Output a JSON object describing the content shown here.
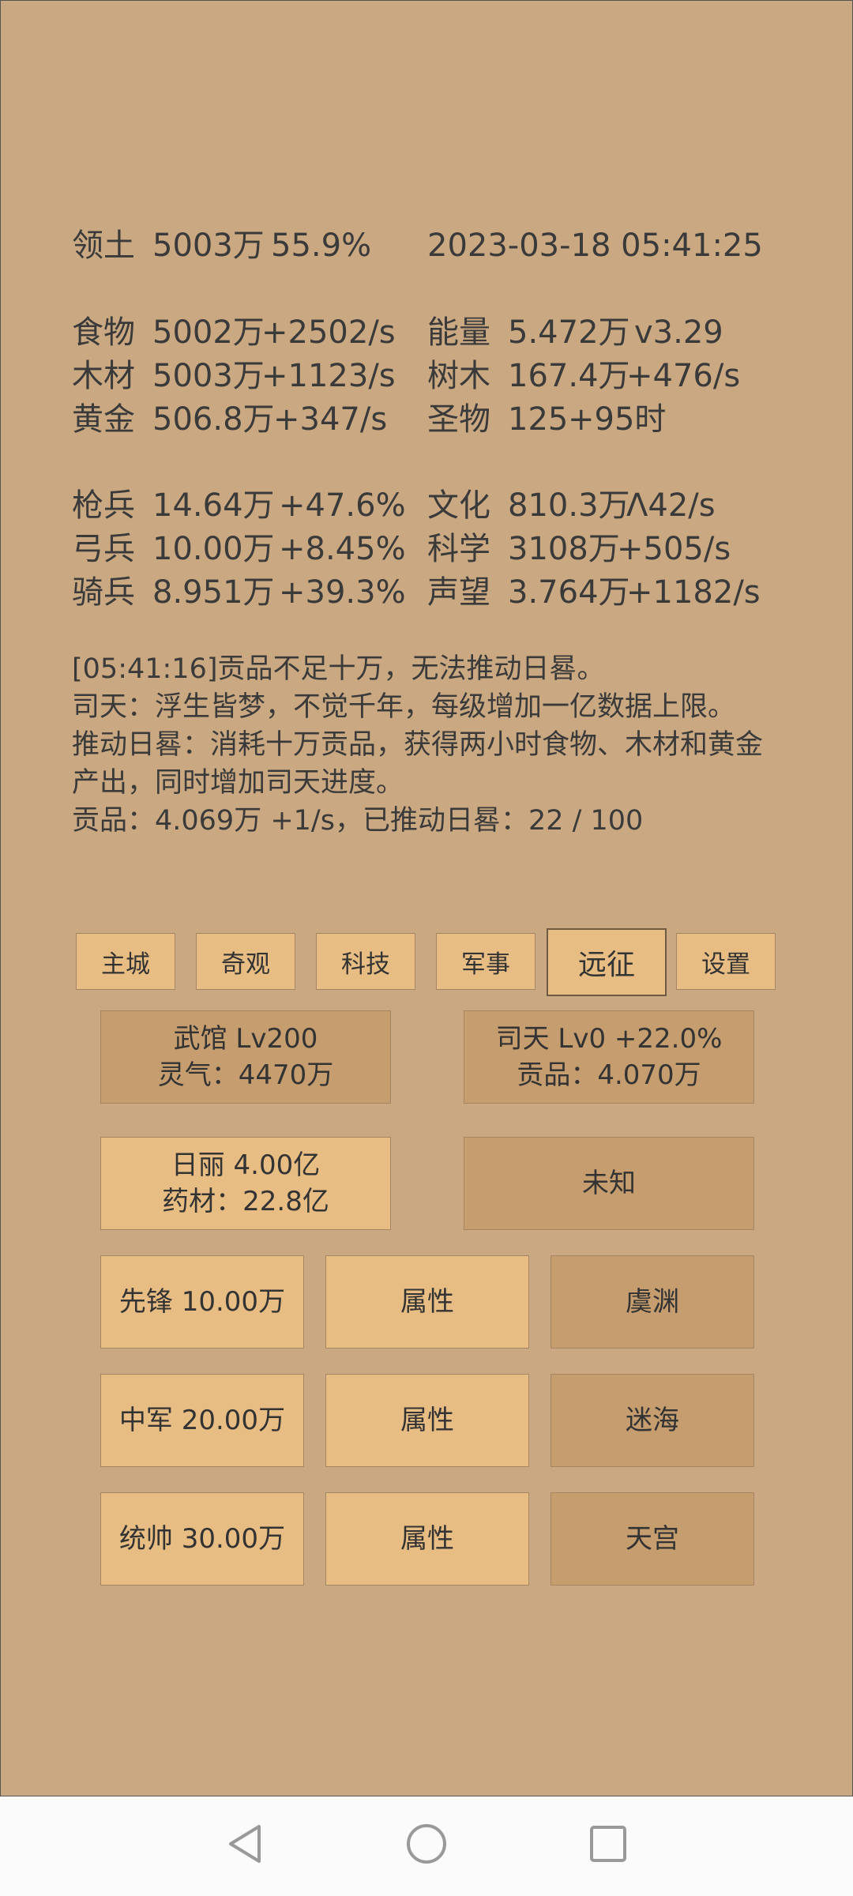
{
  "status": {
    "territory_label": "领土",
    "territory_value": "5003万",
    "territory_pct": "55.9%",
    "datetime": "2023-03-18 05:41:25"
  },
  "resources": {
    "food": {
      "label": "食物",
      "value": "5002万",
      "rate": "+2502/s"
    },
    "energy": {
      "label": "能量",
      "value": "5.472万",
      "extra": "v3.29"
    },
    "wood": {
      "label": "木材",
      "value": "5003万",
      "rate": "+1123/s"
    },
    "tree": {
      "label": "树木",
      "value": "167.4万",
      "rate": "+476/s"
    },
    "gold": {
      "label": "黄金",
      "value": "506.8万",
      "rate": "+347/s"
    },
    "relic": {
      "label": "圣物",
      "value": "125",
      "rate": "+95时"
    }
  },
  "army": {
    "spear": {
      "label": "枪兵",
      "value": "14.64万",
      "rate": "+47.6%"
    },
    "culture": {
      "label": "文化",
      "value": "810.3万",
      "rate": "Λ42/s"
    },
    "archer": {
      "label": "弓兵",
      "value": "10.00万",
      "rate": "+8.45%"
    },
    "science": {
      "label": "科学",
      "value": "3108万",
      "rate": "+505/s"
    },
    "cavalry": {
      "label": "骑兵",
      "value": "8.951万",
      "rate": "+39.3%"
    },
    "prestige": {
      "label": "声望",
      "value": "3.764万",
      "rate": "+1182/s"
    }
  },
  "messages": [
    "[05:41:16]贡品不足十万，无法推动日晷。",
    "司天：浮生皆梦，不觉千年，每级增加一亿数据上限。",
    "推动日晷：消耗十万贡品，获得两小时食物、木材和黄金",
    "产出，同时增加司天进度。",
    "贡品：4.069万 +1/s，已推动日晷：22 / 100"
  ],
  "tabs": [
    "主城",
    "奇观",
    "科技",
    "军事",
    "远征",
    "设置"
  ],
  "active_tab": "远征",
  "panels": {
    "wuguan": {
      "line1": "武馆 Lv200",
      "line2": "灵气：4470万"
    },
    "sitian": {
      "line1": "司天 Lv0 +22.0%",
      "line2": "贡品：4.070万"
    },
    "rili": {
      "line1": "日丽  4.00亿",
      "line2": "药材：22.8亿"
    },
    "unknown": {
      "label": "未知"
    }
  },
  "expedition": [
    {
      "unit": "先锋  10.00万",
      "attr": "属性",
      "target": "虞渊"
    },
    {
      "unit": "中军  20.00万",
      "attr": "属性",
      "target": "迷海"
    },
    {
      "unit": "统帅  30.00万",
      "attr": "属性",
      "target": "天宫"
    }
  ],
  "colors": {
    "background": "#caa982",
    "button_light": "#e8bd83",
    "button_dark": "#c59d6e",
    "text": "#3a3a3a"
  }
}
